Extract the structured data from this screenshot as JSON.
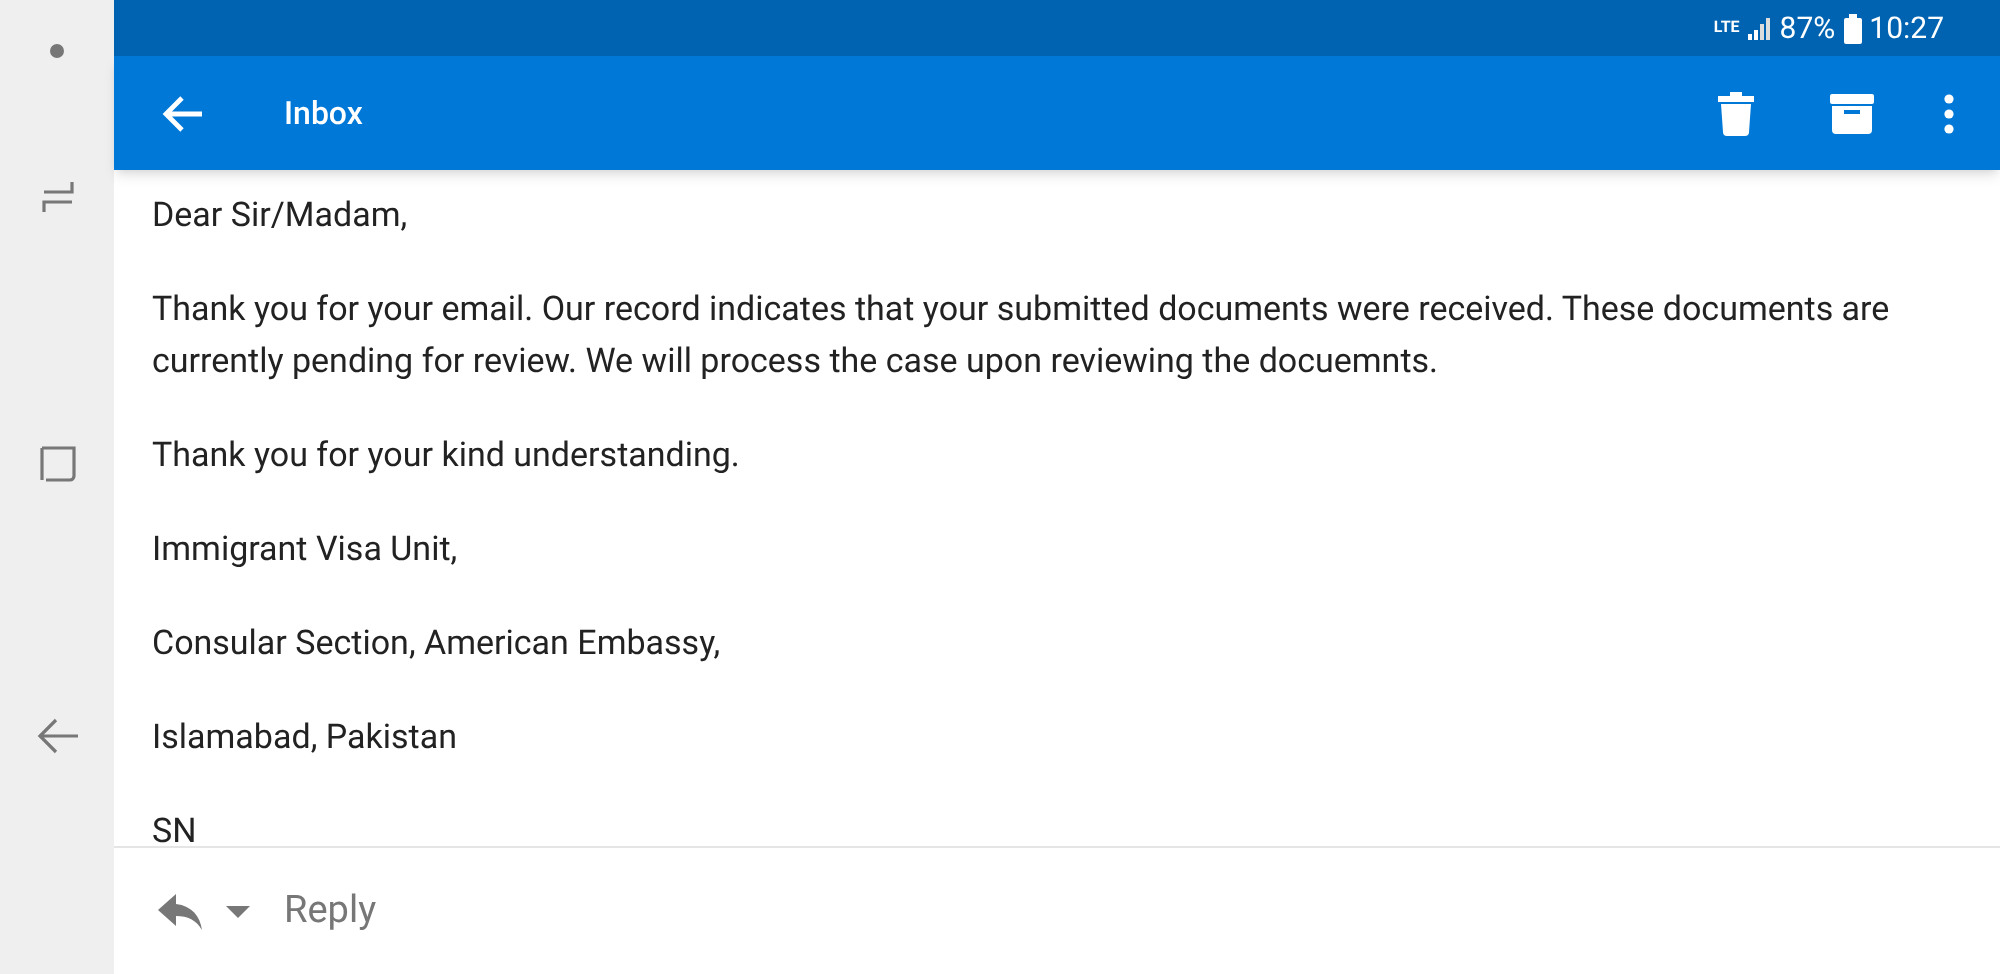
{
  "status_bar": {
    "network": "LTE",
    "battery": "87%",
    "time": "10:27"
  },
  "app_bar": {
    "title": "Inbox"
  },
  "message": {
    "paragraphs": [
      "Dear Sir/Madam,",
      "Thank you for your email. Our record indicates that your submitted documents were received. These documents are currently pending for review. We will process the case upon reviewing the docuemnts.",
      "Thank you for your kind understanding.",
      "Immigrant Visa Unit,",
      "Consular Section, American Embassy,",
      "Islamabad, Pakistan",
      "SN"
    ]
  },
  "reply_bar": {
    "label": "Reply"
  }
}
